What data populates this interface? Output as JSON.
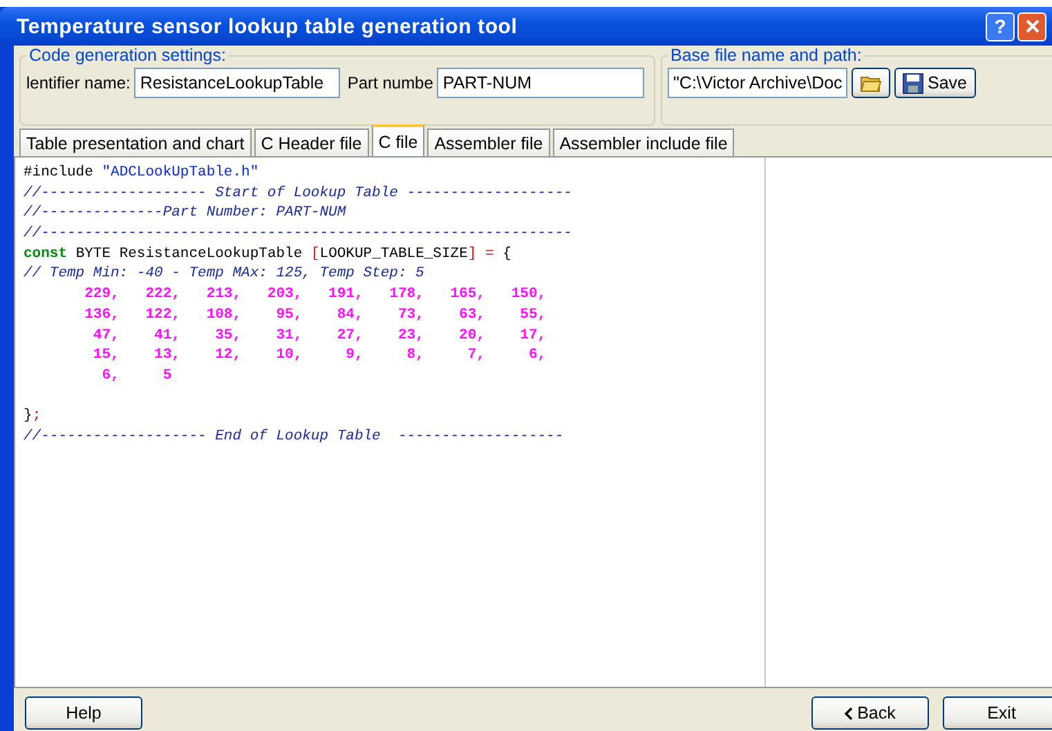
{
  "window": {
    "title": "Temperature sensor lookup table generation tool",
    "help_glyph": "?"
  },
  "code_settings": {
    "legend": "Code generation settings:",
    "identifier_label": "lentifier name:",
    "identifier_value": "ResistanceLookupTable",
    "part_label": "Part numbe",
    "part_value": "PART-NUM"
  },
  "base_file": {
    "legend": "Base file name and path:",
    "path_value": "\"C:\\Victor Archive\\Doc",
    "save_label": "Save"
  },
  "tabs": [
    {
      "label": "Table presentation and chart",
      "selected": false
    },
    {
      "label": "C Header file",
      "selected": false
    },
    {
      "label": "C file",
      "selected": true
    },
    {
      "label": "Assembler file",
      "selected": false
    },
    {
      "label": "Assembler include file",
      "selected": false
    }
  ],
  "code_lines": [
    [
      {
        "kind": "plain",
        "text": "#include "
      },
      {
        "kind": "string",
        "text": "\"ADCLookUpTable.h\""
      }
    ],
    [
      {
        "kind": "comment",
        "text": "//------------------- Start of Lookup Table -------------------"
      }
    ],
    [
      {
        "kind": "comment",
        "text": "//--------------Part Number: PART-NUM"
      }
    ],
    [
      {
        "kind": "comment",
        "text": "//-------------------------------------------------------------"
      }
    ],
    [
      {
        "kind": "keyword",
        "text": "const"
      },
      {
        "kind": "plain",
        "text": " BYTE ResistanceLookupTable "
      },
      {
        "kind": "bracket",
        "text": "["
      },
      {
        "kind": "plain",
        "text": "LOOKUP_TABLE_SIZE"
      },
      {
        "kind": "bracket",
        "text": "] ="
      },
      {
        "kind": "plain",
        "text": " {"
      }
    ],
    [
      {
        "kind": "comment",
        "text": "// Temp Min: -40 - Temp MAx: 125, Temp Step: 5"
      }
    ],
    [
      {
        "kind": "number",
        "text": "       229,   222,   213,   203,   191,   178,   165,   150,"
      }
    ],
    [
      {
        "kind": "number",
        "text": "       136,   122,   108,    95,    84,    73,    63,    55,"
      }
    ],
    [
      {
        "kind": "number",
        "text": "        47,    41,    35,    31,    27,    23,    20,    17,"
      }
    ],
    [
      {
        "kind": "number",
        "text": "        15,    13,    12,    10,     9,     8,     7,     6,"
      }
    ],
    [
      {
        "kind": "number",
        "text": "         6,     5"
      }
    ],
    [
      {
        "kind": "plain",
        "text": "}",
        "gap_before": true
      },
      {
        "kind": "bracket",
        "text": ";"
      }
    ],
    [
      {
        "kind": "comment",
        "text": "//------------------- End of Lookup Table  -------------------"
      }
    ]
  ],
  "buttons": {
    "help": "Help",
    "back": "Back",
    "exit": "Exit"
  }
}
